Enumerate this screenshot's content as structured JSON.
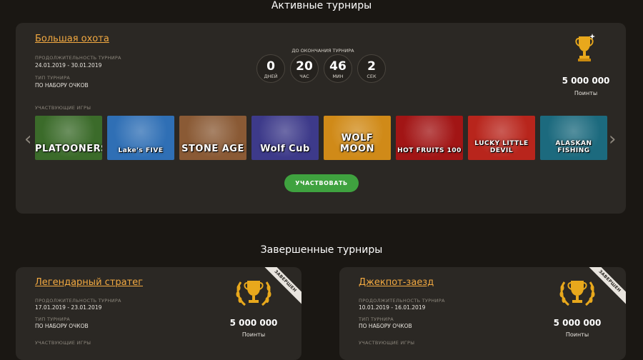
{
  "active": {
    "section_title": "Активные турниры",
    "tournament": {
      "title": "Большая охота",
      "duration_label": "ПРОДОЛЖИТЕЛЬНОСТЬ ТУРНИРА",
      "duration_value": "24.01.2019 - 30.01.2019",
      "type_label": "ТИП ТУРНИРА",
      "type_value": "ПО НАБОРУ ОЧКОВ",
      "countdown_caption": "ДО ОКОНЧАНИЯ ТУРНИРА",
      "countdown": [
        {
          "value": "0",
          "unit": "ДНЕЙ"
        },
        {
          "value": "20",
          "unit": "ЧАС"
        },
        {
          "value": "46",
          "unit": "МИН"
        },
        {
          "value": "2",
          "unit": "СЕК"
        }
      ],
      "prize_amount": "5 000 000",
      "prize_unit": "Поинты",
      "games_label": "УЧАСТВУЮЩИЕ ИГРЫ",
      "games": [
        {
          "name": "PLATOONERS",
          "bg": "#3b6b2a"
        },
        {
          "name": "Lake's FIVE",
          "bg": "#2f6fb5"
        },
        {
          "name": "STONE AGE",
          "bg": "#8a5a35"
        },
        {
          "name": "Wolf Cub",
          "bg": "#3d3a8a"
        },
        {
          "name": "WOLF MOON",
          "bg": "#d08a18"
        },
        {
          "name": "HOT FRUITS 100",
          "bg": "#a21515"
        },
        {
          "name": "LUCKY LITTLE DEVIL",
          "bg": "#b8251c"
        },
        {
          "name": "ALASKAN FISHING",
          "bg": "#1c6a7e"
        }
      ],
      "join_label": "УЧАСТВОВАТЬ"
    }
  },
  "finished": {
    "section_title": "Завершенные турниры",
    "ribbon_label": "ЗАВЕРШЕН",
    "tournaments": [
      {
        "title": "Легендарный стратег",
        "duration_label": "ПРОДОЛЖИТЕЛЬНОСТЬ ТУРНИРА",
        "duration_value": "17.01.2019 - 23.01.2019",
        "type_label": "ТИП ТУРНИРА",
        "type_value": "ПО НАБОРУ ОЧКОВ",
        "games_label": "УЧАСТВУЮЩИЕ ИГРЫ",
        "prize_amount": "5 000 000",
        "prize_unit": "Поинты"
      },
      {
        "title": "Джекпот-заезд",
        "duration_label": "ПРОДОЛЖИТЕЛЬНОСТЬ ТУРНИРА",
        "duration_value": "10.01.2019 - 16.01.2019",
        "type_label": "ТИП ТУРНИРА",
        "type_value": "ПО НАБОРУ ОЧКОВ",
        "games_label": "УЧАСТВУЮЩИЕ ИГРЫ",
        "prize_amount": "5 000 000",
        "prize_unit": "Поинты"
      }
    ]
  },
  "colors": {
    "accent": "#f2a941",
    "button": "#3fa23f",
    "card_bg": "#2b2824",
    "page_bg": "#1a1713",
    "trophy": "#e8a81c"
  }
}
